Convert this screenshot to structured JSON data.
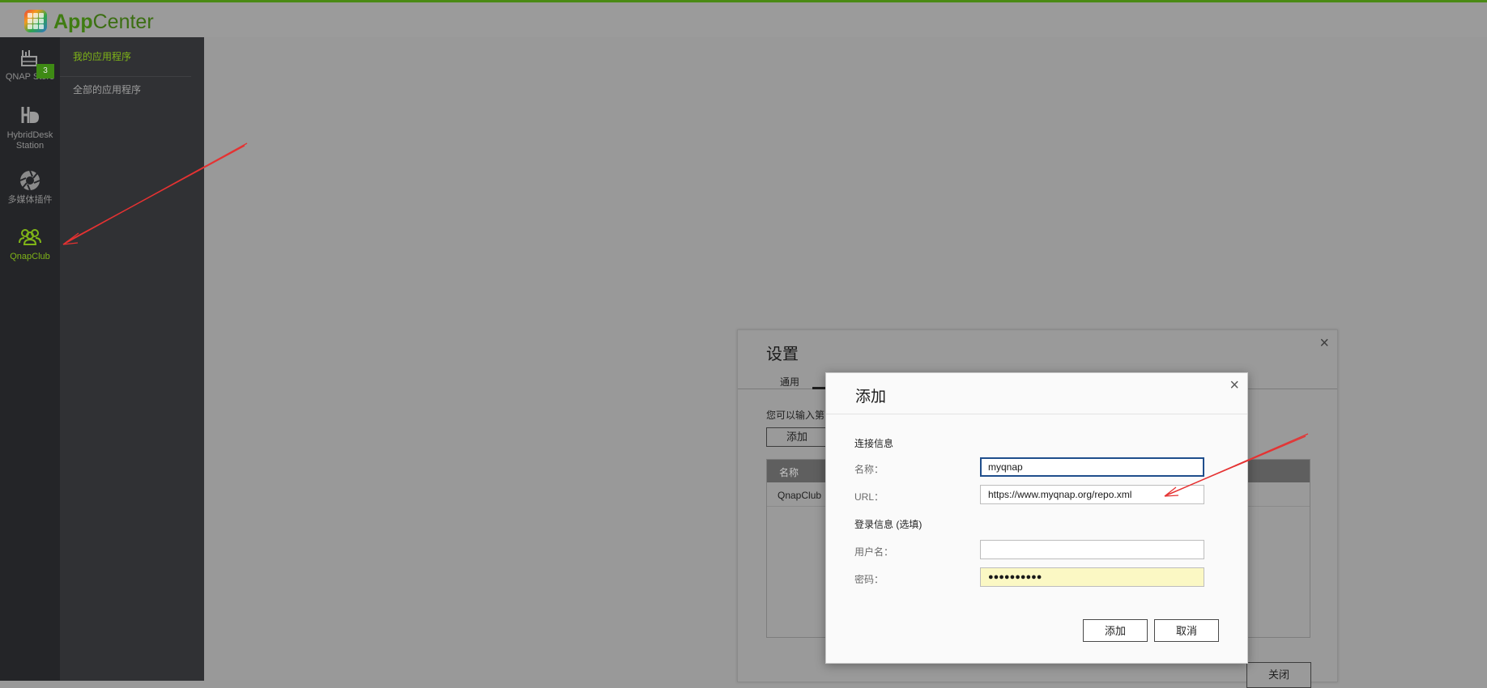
{
  "app": {
    "title_prefix": "App",
    "title_suffix": "Center"
  },
  "colors": {
    "brand_green": "#7fb418",
    "annotation_red": "#e53232",
    "focus_blue": "#1f4e8c",
    "password_fill": "#fbf8c4"
  },
  "iconbar": {
    "items": [
      {
        "label": "QNAP Store",
        "icon": "store-icon",
        "badge": "3",
        "active": false
      },
      {
        "label": "HybridDesk Station",
        "icon": "hd-icon",
        "active": false
      },
      {
        "label": "多媒体插件",
        "icon": "aperture-icon",
        "active": false
      },
      {
        "label": "QnapClub",
        "icon": "group-icon",
        "active": true
      }
    ]
  },
  "sidemenu": {
    "items": [
      {
        "label": "我的应用程序",
        "active": true
      },
      {
        "label": "全部的应用程序",
        "active": false
      }
    ]
  },
  "settings": {
    "title": "设置",
    "close": "×",
    "tab_general": "通用",
    "description": "您可以输入第",
    "add_button": "添加",
    "table": {
      "header_name": "名称",
      "rows": [
        "QnapClub"
      ]
    },
    "close_button": "关闭"
  },
  "add_dialog": {
    "title": "添加",
    "close": "×",
    "connection_section": "连接信息",
    "name_label": "名称：",
    "name_value": "myqnap",
    "url_label": "URL：",
    "url_value": "https://www.myqnap.org/repo.xml",
    "login_section": "登录信息 (选填)",
    "username_label": "用户名：",
    "username_value": "",
    "password_label": "密码：",
    "password_mask": "●●●●●●●●●●",
    "add_button": "添加",
    "cancel_button": "取消"
  }
}
